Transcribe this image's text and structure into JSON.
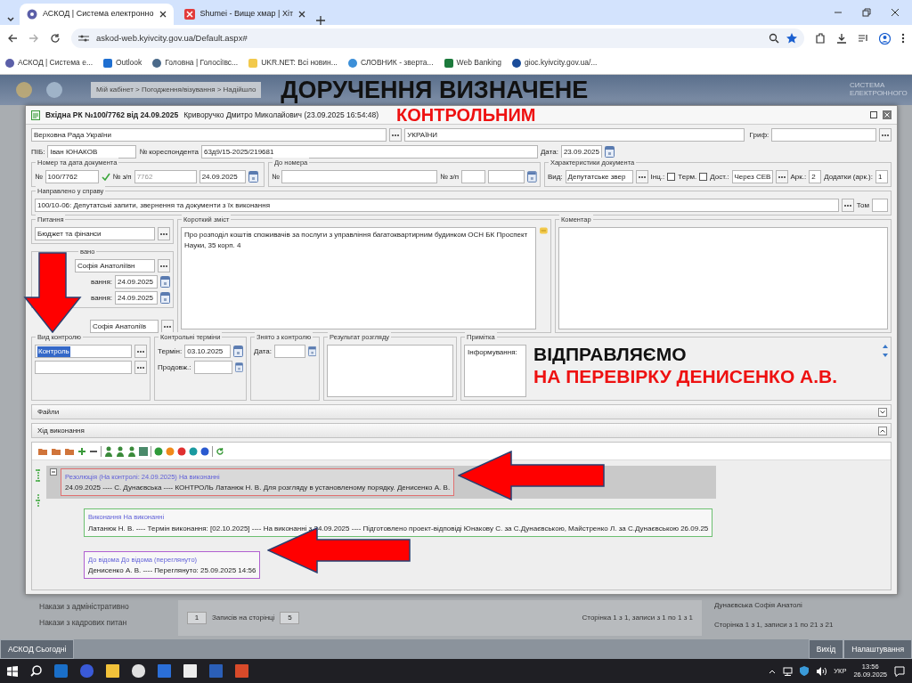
{
  "browser": {
    "tabs": [
      {
        "title": "АСКОД | Система електронно",
        "selected": true
      },
      {
        "title": "Shumei - Вище хмар | Хіт",
        "selected": false
      }
    ],
    "address": "askod-web.kyivcity.gov.ua/Default.aspx#",
    "bookmarks": [
      "АСКОД | Система е...",
      "Outlook",
      "Головна | Голосіївс...",
      "UKR.NET: Всі новин...",
      "СЛОВНИК - зверта...",
      "Web Banking",
      "gioc.kyivcity.gov.ua/..."
    ]
  },
  "background_app": {
    "breadcrumb": "Мій кабінет > Погодження/візування > Надійшло",
    "logo_text": "СИСТЕМА ЕЛЕКТРОННОГО",
    "list_items": [
      "Накази з адміністративно",
      "Накази з кадрових питан"
    ],
    "page_value": "1",
    "records_label": "Записів на сторінці",
    "page_size": "5",
    "page_info": "Сторінка 1 з 1, записи з 1 по 1 з 1",
    "right_name": "Дунаєвська Софія Анатолі",
    "right_info": "Сторінка 1 з 1, записи з 1 по 21 з 21",
    "bottom_left": "АСКОД Сьогодні",
    "bottom_right": [
      "Вихід",
      "Налаштування"
    ]
  },
  "dialog": {
    "title": "Вхідна РК №100/7762 від 24.09.2025",
    "author": "Криворучко Дмитро Миколайович (23.09.2025 16:54:48)",
    "sender": "Верховна Рада України",
    "recipient": "УКРАЇНИ",
    "grif_label": "Гриф:",
    "pib_label": "ПІБ:",
    "pib": "Іван ЮНАКОВ",
    "corr_label": "№ кореспондента",
    "corr": "63д9/15-2025/219681",
    "date_label": "Дата:",
    "date": "23.09.2025",
    "doc_group": {
      "legend": "Номер та дата документа",
      "no_label": "№",
      "no": "100/7762",
      "verified": true,
      "seq_label": "№ з/п",
      "seq": "7762",
      "date": "24.09.2025"
    },
    "to_group": {
      "legend": "До номера",
      "no_label": "№",
      "seq_label": "№ з/п"
    },
    "char_group": {
      "legend": "Характеристики документа",
      "kind_label": "Вид:",
      "kind": "Депутатське звер",
      "inc_label": "Інц.:",
      "inc_checked": false,
      "term_label": "Терм.",
      "term_checked": false,
      "delivery_label": "Дост.:",
      "delivery": "Через СЕВ",
      "sheets_label": "Арк.:",
      "sheets": "2",
      "att_label": "Додатки (арк.):",
      "att": "1"
    },
    "case_group": {
      "legend": "Направлено у справу",
      "value": "100/10-06: Депутатські запити, звернення та документи з їх виконання",
      "volume_label": "Том"
    },
    "question_group": {
      "legend": "Питання",
      "value": "Бюджет та фінанси"
    },
    "controlled_group": {
      "legend": "вано",
      "executor": "Софія Анатоліївн",
      "dates": [
        {
          "label": "вання:",
          "value": "24.09.2025"
        },
        {
          "label": "вання:",
          "value": "24.09.2025"
        }
      ]
    },
    "signer": "Софія Анатоліїв",
    "summary_group": {
      "legend": "Короткий зміст",
      "value": "Про розподіл коштів споживачів за послуги з управління багатоквартирним  будинком ОСН БК Проспект Науки, 35 корп. 4"
    },
    "comment_group": {
      "legend": "Коментар"
    },
    "control_group": {
      "legend": "Вид контролю",
      "value": "Контроль",
      "value_selected": true
    },
    "terms_group": {
      "legend": "Контрольні терміни",
      "term_label": "Термін:",
      "term": "03.10.2025",
      "ext_label": "Продовж.:"
    },
    "removed_group": {
      "legend": "Знято з контролю",
      "date_label": "Дата:"
    },
    "result_group": {
      "legend": "Результат розгляду"
    },
    "note_group": {
      "legend": "Примітка",
      "value": "Інформування:"
    },
    "panels": [
      {
        "title": "Файли",
        "kind": "files",
        "expanded": false
      },
      {
        "title": "Хід виконання",
        "kind": "history",
        "expanded": true
      }
    ],
    "history": [
      {
        "header": "Резолюція (На контролі: 24.09.2025) На виконанні",
        "text": "24.09.2025 ---- С. Дунаєвська ---- КОНТРОЛЬ Латанюк Н. В. Для розгляду в установленому порядку. Денисенко А. В.",
        "color": "#e07070",
        "selected": true,
        "children": [
          {
            "header": "Виконання На виконанні",
            "text": "Латанюк Н. В. ---- Термін виконання: [02.10.2025] ---- На виконанні з 24.09.2025 ---- Підготовлено проект-відповіді Юнакову С. за С.Дунаєвською, Майстренко Л. за С.Дунаєвською 26.09.25",
            "color": "#6cc070",
            "selected": false
          },
          {
            "header": "До відома До відома (переглянуто)",
            "text": "Денисенко А. В. ---- Переглянуто: 25.09.2025 14:56",
            "color": "#b060d0",
            "selected": false
          }
        ]
      }
    ]
  },
  "annotations": [
    {
      "text": "ДОРУЧЕННЯ ВИЗНАЧЕНЕ",
      "color": "#111111"
    },
    {
      "text": "КОНТРОЛЬНИМ",
      "color": "#ee1111"
    },
    {
      "text": "ВІДПРАВЛЯЄМО",
      "color": "#111111"
    },
    {
      "text": "НА ПЕРЕВІРКУ ДЕНИСЕНКО А.В.",
      "color": "#ee1111"
    }
  ],
  "taskbar": {
    "language": "УКР",
    "time": "13:56",
    "date": "26.09.2025"
  }
}
